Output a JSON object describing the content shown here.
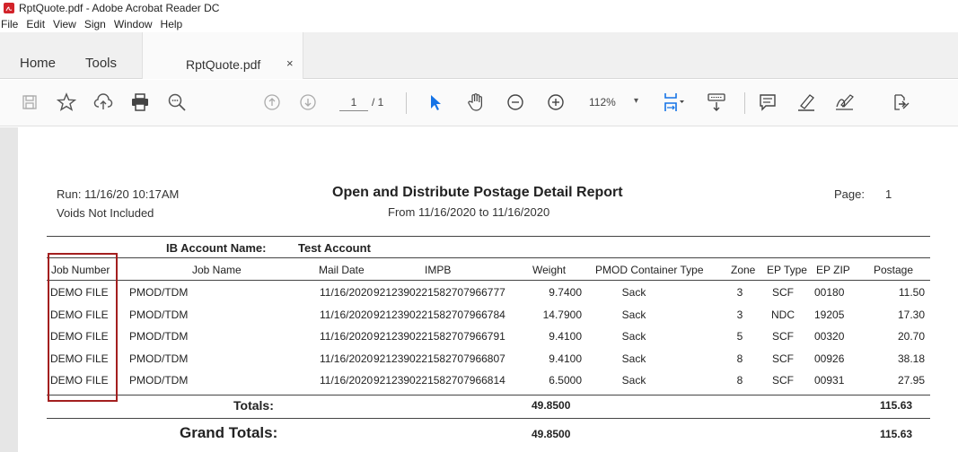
{
  "window": {
    "title": "RptQuote.pdf - Adobe Acrobat Reader DC"
  },
  "menu": [
    "File",
    "Edit",
    "View",
    "Sign",
    "Window",
    "Help"
  ],
  "tabs": {
    "home": "Home",
    "tools": "Tools",
    "document": "RptQuote.pdf",
    "close": "×"
  },
  "toolbar": {
    "icons": [
      "save-icon",
      "bookmark-star-icon",
      "upload-cloud-icon",
      "print-icon",
      "search-zoom-icon",
      "page-up-icon",
      "page-down-icon",
      "select-arrow-icon",
      "hand-icon",
      "zoom-out-icon",
      "zoom-in-icon",
      "fit-page-icon",
      "scroll-mode-icon",
      "comment-icon",
      "highlight-pen-icon",
      "sign-icon",
      "share-icon"
    ],
    "page_current": "1",
    "page_total": "/ 1",
    "zoom": "112%",
    "zoom_caret": "▾"
  },
  "report": {
    "run": "Run:  11/16/20 10:17AM",
    "voids": "Voids Not Included",
    "title": "Open and Distribute Postage Detail Report",
    "date_range": "From 11/16/2020 to 11/16/2020",
    "page_label": "Page:",
    "page_number": "1",
    "account_label": "IB Account Name:",
    "account_value": "Test Account",
    "headers": {
      "job_number": "Job Number",
      "job_name": "Job Name",
      "mail_date": "Mail Date",
      "impb": "IMPB",
      "weight": "Weight",
      "container": "PMOD Container Type",
      "zone": "Zone",
      "ep_type": "EP Type",
      "ep_zip": "EP ZIP",
      "postage": "Postage"
    },
    "rows": [
      {
        "job_number": "DEMO FILE",
        "job_name": "PMOD/TDM",
        "mail_date": "11/16/2020",
        "impb": "9212390221582707966777",
        "weight": "9.7400",
        "container": "Sack",
        "zone": "3",
        "ep_type": "SCF",
        "ep_zip": "00180",
        "postage": "11.50"
      },
      {
        "job_number": "DEMO FILE",
        "job_name": "PMOD/TDM",
        "mail_date": "11/16/2020",
        "impb": "9212390221582707966784",
        "weight": "14.7900",
        "container": "Sack",
        "zone": "3",
        "ep_type": "NDC",
        "ep_zip": "19205",
        "postage": "17.30"
      },
      {
        "job_number": "DEMO FILE",
        "job_name": "PMOD/TDM",
        "mail_date": "11/16/2020",
        "impb": "9212390221582707966791",
        "weight": "9.4100",
        "container": "Sack",
        "zone": "5",
        "ep_type": "SCF",
        "ep_zip": "00320",
        "postage": "20.70"
      },
      {
        "job_number": "DEMO FILE",
        "job_name": "PMOD/TDM",
        "mail_date": "11/16/2020",
        "impb": "9212390221582707966807",
        "weight": "9.4100",
        "container": "Sack",
        "zone": "8",
        "ep_type": "SCF",
        "ep_zip": "00926",
        "postage": "38.18"
      },
      {
        "job_number": "DEMO FILE",
        "job_name": "PMOD/TDM",
        "mail_date": "11/16/2020",
        "impb": "9212390221582707966814",
        "weight": "6.5000",
        "container": "Sack",
        "zone": "8",
        "ep_type": "SCF",
        "ep_zip": "00931",
        "postage": "27.95"
      }
    ],
    "totals": {
      "label": "Totals:",
      "weight": "49.8500",
      "postage": "115.63"
    },
    "grand_totals": {
      "label": "Grand Totals:",
      "weight": "49.8500",
      "postage": "115.63"
    }
  },
  "colors": {
    "highlight_box": "#a31f1f",
    "select_tool": "#1473e6",
    "pdf_logo": "#d2232a"
  }
}
